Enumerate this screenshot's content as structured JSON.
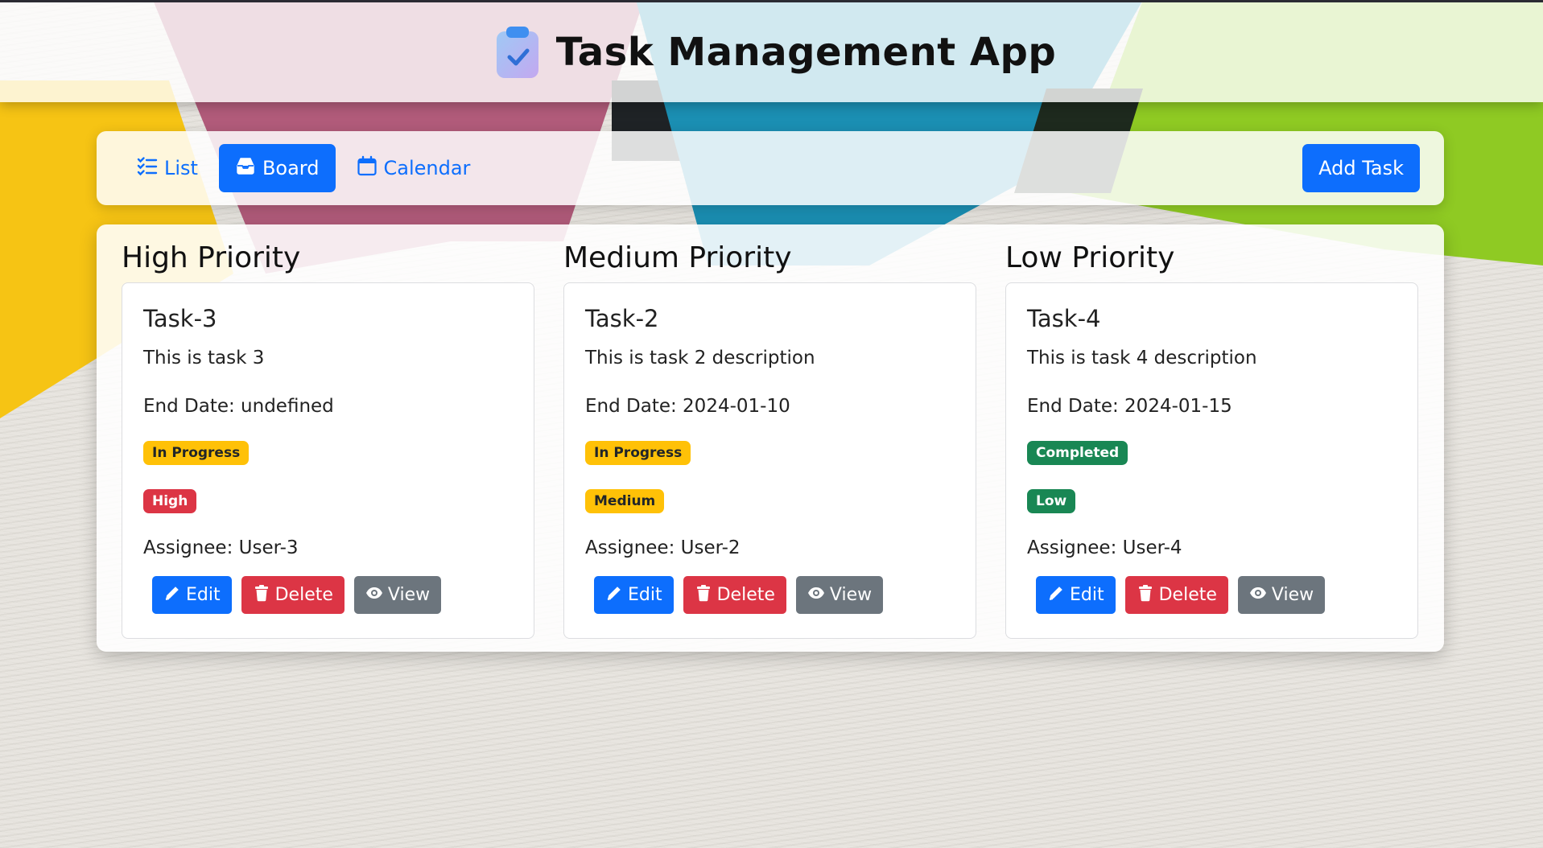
{
  "app": {
    "title": "Task Management App"
  },
  "toolbar": {
    "views": [
      {
        "label": "List",
        "icon": "list-check-icon",
        "active": false
      },
      {
        "label": "Board",
        "icon": "inbox-tray-icon",
        "active": true
      },
      {
        "label": "Calendar",
        "icon": "calendar-icon",
        "active": false
      }
    ],
    "add_task_label": "Add Task"
  },
  "colors": {
    "primary": "#0d6efd",
    "danger": "#dc3545",
    "secondary": "#6c757d",
    "warning": "#ffc107",
    "success": "#198754"
  },
  "columns": [
    {
      "title": "High Priority",
      "task": {
        "name": "Task-3",
        "description": "This is task 3",
        "end_date": "End Date: undefined",
        "status": "In Progress",
        "priority": "High",
        "assignee": "Assignee: User-3"
      }
    },
    {
      "title": "Medium Priority",
      "task": {
        "name": "Task-2",
        "description": "This is task 2 description",
        "end_date": "End Date: 2024-01-10",
        "status": "In Progress",
        "priority": "Medium",
        "assignee": "Assignee: User-2"
      }
    },
    {
      "title": "Low Priority",
      "task": {
        "name": "Task-4",
        "description": "This is task 4 description",
        "end_date": "End Date: 2024-01-15",
        "status": "Completed",
        "priority": "Low",
        "assignee": "Assignee: User-4"
      }
    }
  ],
  "card_actions": {
    "edit": "Edit",
    "delete": "Delete",
    "view": "View"
  }
}
